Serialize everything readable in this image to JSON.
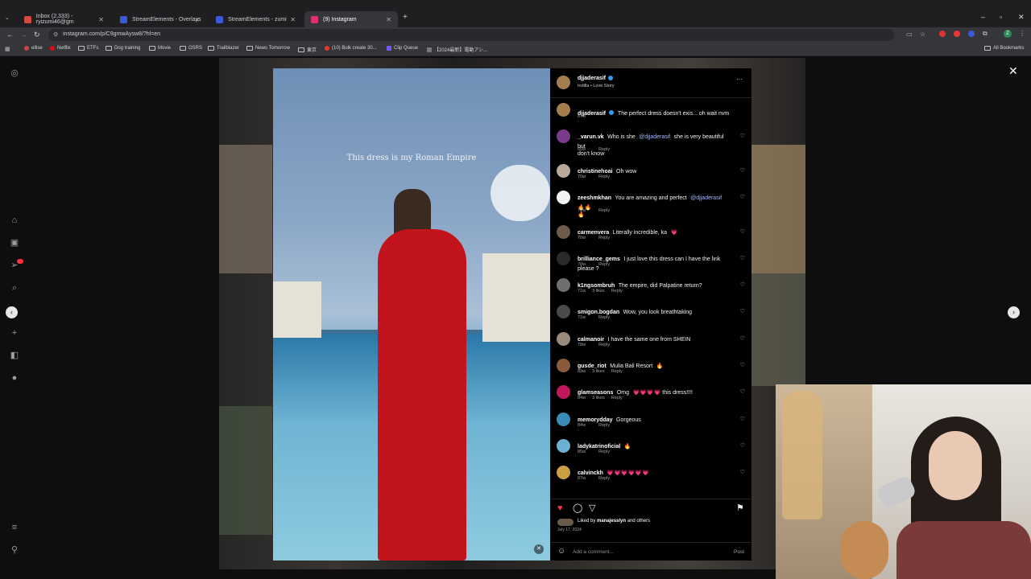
{
  "browser": {
    "tabs": [
      {
        "label": "Inbox (2,333) - ryizumi46@gm",
        "color": "#d24b3e",
        "active": false
      },
      {
        "label": "StreamElements - Overlays",
        "color": "#3a5bd9",
        "active": false
      },
      {
        "label": "StreamElements - zumi",
        "color": "#3a5bd9",
        "active": false
      },
      {
        "label": "(9) Instagram",
        "color": "#e1306c",
        "active": true
      }
    ],
    "url": "instagram.com/p/C9gmwAysw8/?hl=en",
    "bookmarks": [
      "ellise",
      "Netflix",
      "ETFs",
      "Dog training",
      "Movie",
      "OSRS",
      "Trailblazer",
      "News Tomorrow",
      "東京",
      "(10) Bulk create 30...",
      "Clip Queue",
      "【2024最新】電動アシ...",
      "All Bookmarks"
    ]
  },
  "post": {
    "overlay_text": "This dress is my Roman Empire",
    "author": "djjaderasif",
    "audio": "Indilla • Love Story",
    "caption_user": "djjaderasif",
    "caption_text": "The perfect dress doesn't exis... oh wait nvm",
    "caption_time": "87w",
    "liked_by_prefix": "Liked by",
    "liked_by_user": "manajesslyn",
    "liked_by_suffix": "and others",
    "date": "July 17, 2024",
    "add_comment_placeholder": "Add a comment...",
    "post_label": "Post"
  },
  "comments": [
    {
      "user": "_varun.vk",
      "text": "Who is she",
      "mention": "@djjaderasif",
      "text2": "she is very beautiful but",
      "line2": "don't know",
      "time": "66w",
      "likes": "",
      "reply": "Reply"
    },
    {
      "user": "christinehoai",
      "text": "Oh wow",
      "mention": "",
      "text2": "",
      "line2": "",
      "time": "70w",
      "likes": "",
      "reply": "Reply"
    },
    {
      "user": "zeeshmkhan",
      "text": "You are amazing and perfect",
      "mention": "@djjaderasif",
      "text2": "🔥🔥",
      "line2": "🔥",
      "time": "70w",
      "likes": "",
      "reply": "Reply"
    },
    {
      "user": "carmenvera",
      "text": "Literally incredible, ka",
      "mention": "",
      "text2": "💗",
      "line2": "",
      "time": "70w",
      "likes": "",
      "reply": "Reply"
    },
    {
      "user": "brilliance_gems",
      "text": "I just love this dress can I have the link please ?",
      "mention": "",
      "text2": "",
      "line2": "",
      "time": "70w",
      "likes": "",
      "reply": "Reply"
    },
    {
      "user": "k1ngsombruh",
      "text": "The empire, did Palpatine return?",
      "mention": "",
      "text2": "",
      "line2": "",
      "time": "71w",
      "likes": "3 likes",
      "reply": "Reply"
    },
    {
      "user": "smigon.bogdan",
      "text": "Wow, you look breathtaking",
      "mention": "",
      "text2": "",
      "line2": "",
      "time": "71w",
      "likes": "",
      "reply": "Reply"
    },
    {
      "user": "calmanoir",
      "text": "I have the same one from SHEIN",
      "mention": "",
      "text2": "",
      "line2": "",
      "time": "78w",
      "likes": "",
      "reply": "Reply"
    },
    {
      "user": "gusde_riot",
      "text": "Mulia Bali Resort",
      "mention": "",
      "text2": "🔥",
      "line2": "",
      "time": "83w",
      "likes": "3 likes",
      "reply": "Reply"
    },
    {
      "user": "glamseasons",
      "text": "Omg",
      "mention": "",
      "text2": "💗💗💗💗 this dress!!!!",
      "line2": "",
      "time": "84w",
      "likes": "3 likes",
      "reply": "Reply"
    },
    {
      "user": "memorydday",
      "text": "Gorgeous",
      "mention": "",
      "text2": "",
      "line2": "",
      "time": "84w",
      "likes": "",
      "reply": "Reply"
    },
    {
      "user": "ladykatrinoficial",
      "text": "🔥",
      "mention": "",
      "text2": "",
      "line2": "",
      "time": "85w",
      "likes": "",
      "reply": "Reply"
    },
    {
      "user": "calvinckh",
      "text": "💗💗💗💗💗💗",
      "mention": "",
      "text2": "",
      "line2": "",
      "time": "87w",
      "likes": "",
      "reply": "Reply"
    }
  ],
  "colors": {
    "accent_like": "#ff3040",
    "mention": "#a9b8ff",
    "verified": "#3897f0"
  }
}
